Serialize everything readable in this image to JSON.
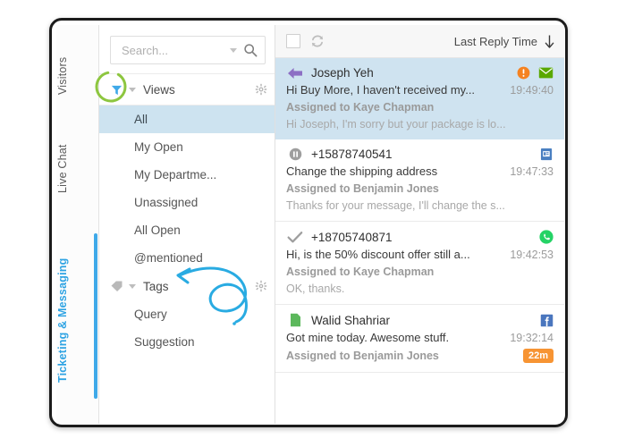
{
  "app": {
    "rail_tabs": [
      {
        "label": "Visitors",
        "active": false
      },
      {
        "label": "Live Chat",
        "active": false
      },
      {
        "label": "Ticketing & Messaging",
        "active": true
      }
    ]
  },
  "search": {
    "value": "",
    "placeholder": "Search...",
    "dropdown_icon": "chevron-down-icon",
    "search_icon": "search-icon"
  },
  "sidebar": {
    "views_group": {
      "label": "Views",
      "icon": "filter-funnel-icon",
      "settings_icon": "gear-icon"
    },
    "views_items": [
      {
        "label": "All",
        "selected": true
      },
      {
        "label": "My Open",
        "selected": false
      },
      {
        "label": "My Departme...",
        "selected": false
      },
      {
        "label": "Unassigned",
        "selected": false
      },
      {
        "label": "All Open",
        "selected": false
      },
      {
        "label": "@mentioned",
        "selected": false
      }
    ],
    "tags_group": {
      "label": "Tags",
      "icon": "tag-icon",
      "settings_icon": "gear-icon"
    },
    "tags_items": [
      {
        "label": "Query"
      },
      {
        "label": "Suggestion"
      }
    ]
  },
  "list_header": {
    "select_all_icon": "checkbox-icon",
    "refresh_icon": "refresh-icon",
    "sort_label": "Last Reply Time",
    "sort_direction_icon": "arrow-down-icon"
  },
  "conversations": [
    {
      "status_icon": "reply-arrow-icon",
      "status_color": "#8d6fc4",
      "name": "Joseph Yeh",
      "subject": "Hi Buy More, I haven't received my...",
      "time": "19:49:40",
      "assigned": "Assigned to Kaye Chapman",
      "preview": "Hi Joseph, I'm sorry but your package is lo...",
      "badges": [
        "alert-exclamation-icon",
        "email-envelope-icon"
      ],
      "channel": "email",
      "pill": "",
      "active": true
    },
    {
      "status_icon": "pause-icon",
      "status_color": "#9e9e9e",
      "name": "+15878740541",
      "subject": "Change the shipping address",
      "time": "19:47:33",
      "assigned": "Assigned to Benjamin Jones",
      "preview": "Thanks for your message, I'll change the s...",
      "badges": [
        "sms-icon"
      ],
      "channel": "sms",
      "pill": "",
      "active": false
    },
    {
      "status_icon": "check-icon",
      "status_color": "#9e9e9e",
      "name": "+18705740871",
      "subject": "Hi, is the 50% discount offer still a...",
      "time": "19:42:53",
      "assigned": "Assigned to Kaye Chapman",
      "preview": "OK, thanks.",
      "badges": [
        "whatsapp-icon"
      ],
      "channel": "whatsapp",
      "pill": "",
      "active": false
    },
    {
      "status_icon": "note-page-icon",
      "status_color": "#5cb85c",
      "name": "Walid Shahriar",
      "subject": "Got mine today. Awesome stuff.",
      "time": "19:32:14",
      "assigned": "Assigned to Benjamin Jones",
      "preview": "",
      "badges": [
        "facebook-icon"
      ],
      "channel": "facebook",
      "pill": "22m",
      "active": false
    }
  ],
  "annotations": {
    "highlight_circle": {
      "target": "filter-funnel-icon",
      "color": "#8dc63f"
    },
    "arrow": {
      "target": "Tags",
      "color": "#29abe2"
    }
  },
  "colors": {
    "accent_blue": "#3fa9e8",
    "selected_row": "#cde3f0",
    "pill_orange": "#f79433",
    "annotation_green": "#8dc63f",
    "annotation_blue": "#29abe2"
  }
}
